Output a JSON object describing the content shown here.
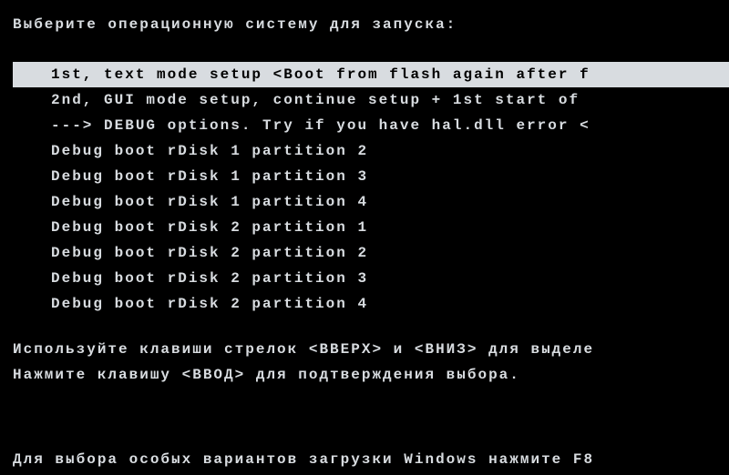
{
  "header": {
    "title": "Выберите операционную систему для запуска:"
  },
  "boot_options": [
    {
      "label": "1st, text mode setup <Boot from flash again after f",
      "selected": true
    },
    {
      "label": "2nd, GUI mode setup, continue setup + 1st start of ",
      "selected": false
    },
    {
      "label": "---> DEBUG options. Try if you have hal.dll error <",
      "selected": false
    },
    {
      "label": "Debug boot rDisk 1 partition 2",
      "selected": false
    },
    {
      "label": "Debug boot rDisk 1 partition 3",
      "selected": false
    },
    {
      "label": "Debug boot rDisk 1 partition 4",
      "selected": false
    },
    {
      "label": "Debug boot rDisk 2 partition 1",
      "selected": false
    },
    {
      "label": "Debug boot rDisk 2 partition 2",
      "selected": false
    },
    {
      "label": "Debug boot rDisk 2 partition 3",
      "selected": false
    },
    {
      "label": "Debug boot rDisk 2 partition 4",
      "selected": false
    }
  ],
  "instructions": {
    "line1": "Используйте клавиши стрелок <ВВЕРХ> и <ВНИЗ> для выделе",
    "line2": "Нажмите клавишу <ВВОД> для подтверждения выбора."
  },
  "footer": {
    "text": "Для выбора особых вариантов загрузки Windows нажмите F8"
  }
}
